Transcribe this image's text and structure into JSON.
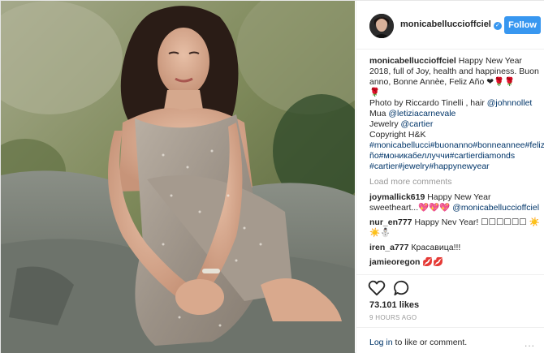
{
  "post": {
    "username": "monicabelluccioffciel",
    "follow_label": "Follow",
    "verified_glyph": "✓"
  },
  "caption": {
    "username": "monicabelluccioffciel",
    "line1": "Happy New Year 2018, full of Joy, health and happiness. Buon anno, Bonne Annèe, Feliz Año ❤🌹🌹",
    "line1b": "🌹",
    "photo_credit_prefix": "Photo by Riccardo Tinelli , hair ",
    "photo_credit_hair": "@johnnollet",
    "mua_prefix": "Mua ",
    "mua_handle": "@letiziacarnevale",
    "jewelry_prefix": "Jewelry ",
    "jewelry_handle": "@cartier",
    "copyright": "Copyright H&K",
    "hashtags": "#monicabellucci#buonanno#bonneannee#feliza ño#моникабеллуччи#cartierdiamonds #cartier#jewelry#happynewyear"
  },
  "load_more": "Load more comments",
  "comments": [
    {
      "user": "joymallick619",
      "text": "Happy New Year sweetheart...💖💖💖",
      "mention": "@monicabelluccioffciel"
    },
    {
      "user": "nur_en777",
      "text": "Happy Nev Year! ☐☐☐☐☐☐ ☀️☀️⛄",
      "mention": ""
    },
    {
      "user": "iren_a777",
      "text": "Красавица!!!",
      "mention": ""
    },
    {
      "user": "jamieoregon",
      "text": "💋💋",
      "mention": ""
    }
  ],
  "likes": "73.101 likes",
  "time": "9 HOURS AGO",
  "login": {
    "link": "Log in",
    "rest": " to like or comment.",
    "more": "..."
  },
  "icons": {
    "heart": "heart-icon",
    "comment": "comment-icon",
    "verified": "verified-badge-icon",
    "more": "more-options-icon"
  },
  "colors": {
    "follow_bg": "#3897f0",
    "link": "#003569",
    "muted": "#999999"
  }
}
